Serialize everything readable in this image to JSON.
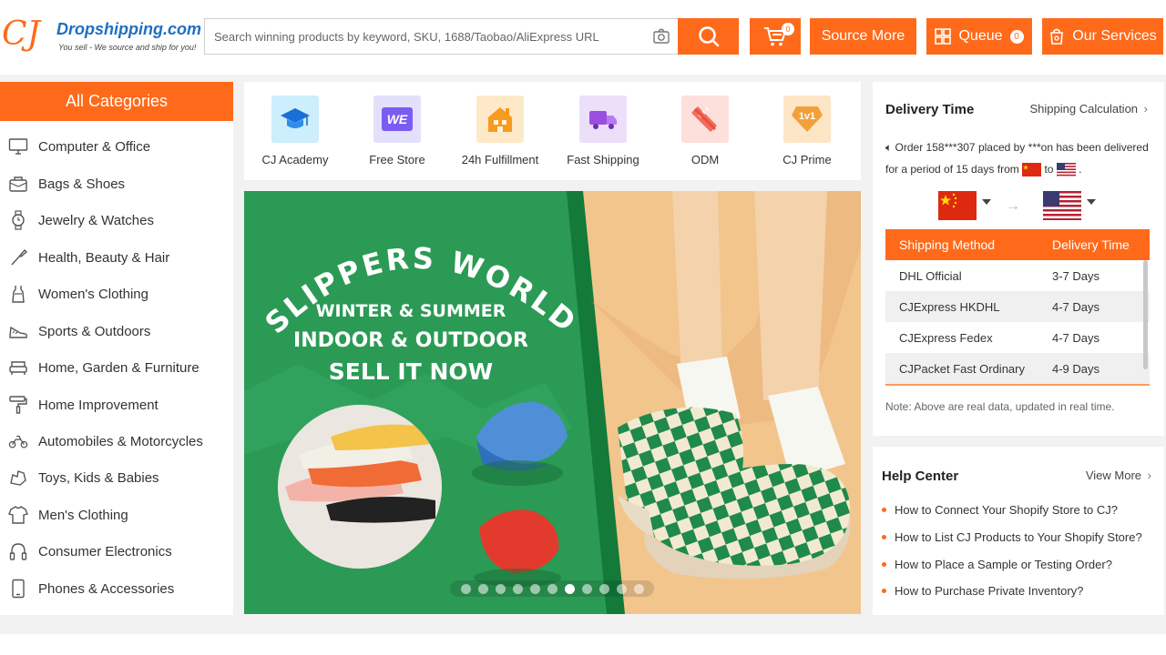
{
  "header": {
    "logo_mark": "CJ",
    "logo_name": "Dropshipping.com",
    "logo_tagline": "You sell - We source and ship for you!",
    "search_placeholder": "Search winning products by keyword, SKU, 1688/Taobao/AliExpress URL",
    "cart_count": "0",
    "source_more": "Source More",
    "queue": "Queue",
    "queue_count": "0",
    "our_services": "Our Services",
    "accent_color": "#ff6a1a"
  },
  "categories": {
    "title": "All Categories",
    "items": [
      {
        "label": "Computer & Office",
        "icon": "monitor-icon"
      },
      {
        "label": "Bags & Shoes",
        "icon": "bag-icon"
      },
      {
        "label": "Jewelry & Watches",
        "icon": "watch-icon"
      },
      {
        "label": "Health, Beauty & Hair",
        "icon": "brush-icon"
      },
      {
        "label": "Women's Clothing",
        "icon": "dress-icon"
      },
      {
        "label": "Sports & Outdoors",
        "icon": "sneaker-icon"
      },
      {
        "label": "Home, Garden & Furniture",
        "icon": "sofa-icon"
      },
      {
        "label": "Home Improvement",
        "icon": "paint-roller-icon"
      },
      {
        "label": "Automobiles & Motorcycles",
        "icon": "motorcycle-icon"
      },
      {
        "label": "Toys, Kids & Babies",
        "icon": "toy-icon"
      },
      {
        "label": "Men's Clothing",
        "icon": "shirt-icon"
      },
      {
        "label": "Consumer Electronics",
        "icon": "headphones-icon"
      },
      {
        "label": "Phones & Accessories",
        "icon": "phone-icon"
      }
    ]
  },
  "features": [
    {
      "label": "CJ Academy",
      "icon": "graduation-cap-icon"
    },
    {
      "label": "Free Store",
      "icon": "we-store-icon",
      "icon_text": "WE"
    },
    {
      "label": "24h Fulfillment",
      "icon": "warehouse-icon"
    },
    {
      "label": "Fast Shipping",
      "icon": "truck-icon"
    },
    {
      "label": "ODM",
      "icon": "ruler-pencil-icon"
    },
    {
      "label": "CJ Prime",
      "icon": "prime-diamond-icon",
      "icon_text": "1v1"
    }
  ],
  "banner": {
    "arc_title": "SLIPPERS WORLD",
    "line1": "WINTER & SUMMER",
    "line2": "INDOOR & OUTDOOR",
    "line3": "SELL IT NOW",
    "slide_count": 11,
    "active_slide": 7
  },
  "delivery": {
    "title": "Delivery Time",
    "calc_link": "Shipping Calculation",
    "message_part1": "Order 158***307 placed by ***on has been delivered for a period of 15 days from",
    "message_to": "to",
    "message_end": ".",
    "from_country": "China",
    "to_country": "United States",
    "table_headers": [
      "Shipping Method",
      "Delivery Time"
    ],
    "rows": [
      {
        "method": "DHL Official",
        "time": "3-7 Days"
      },
      {
        "method": "CJExpress HKDHL",
        "time": "4-7 Days"
      },
      {
        "method": "CJExpress Fedex",
        "time": "4-7 Days"
      },
      {
        "method": "CJPacket Fast Ordinary",
        "time": "4-9 Days"
      }
    ],
    "note": "Note: Above are real data, updated in real time."
  },
  "help": {
    "title": "Help Center",
    "more": "View More",
    "items": [
      "How to Connect Your Shopify Store to CJ?",
      "How to List CJ Products to Your Shopify Store?",
      "How to Place a Sample or Testing Order?",
      "How to Purchase Private Inventory?"
    ]
  }
}
